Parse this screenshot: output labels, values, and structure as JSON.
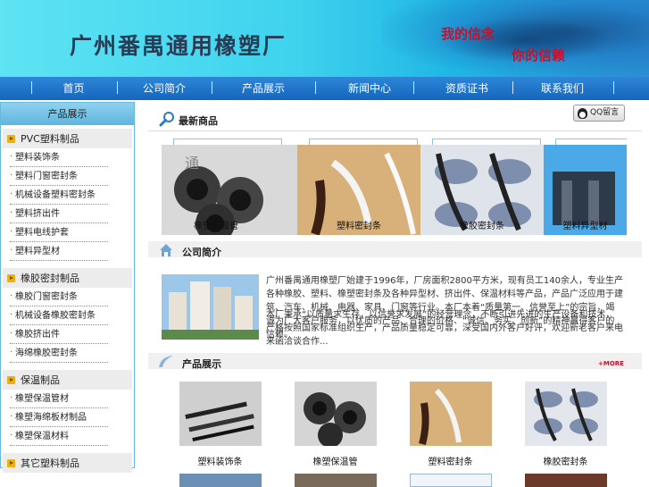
{
  "header": {
    "company": "广州番禺通用橡塑厂",
    "slogan_1": "我的信念",
    "slogan_2": "你的信赖"
  },
  "nav": {
    "items": [
      "首页",
      "公司简介",
      "产品展示",
      "新闻中心",
      "资质证书",
      "联系我们"
    ]
  },
  "sidebar": {
    "title": "产品展示",
    "categories": [
      {
        "label": "PVC塑料制品",
        "items": [
          "塑料装饰条",
          "塑料门窗密封条",
          "机械设备塑料密封条",
          "塑料挤出件",
          "塑料电线护套",
          "塑料异型材"
        ]
      },
      {
        "label": "橡胶密封制品",
        "items": [
          "橡胶门窗密封条",
          "机械设备橡胶密封条",
          "橡胶挤出件",
          "海绵橡胶密封条"
        ]
      },
      {
        "label": "保温制品",
        "items": [
          "橡塑保温管材",
          "橡塑海绵板材制品",
          "橡塑保温材料"
        ]
      },
      {
        "label": "其它塑料制品",
        "items": []
      }
    ]
  },
  "latest": {
    "title": "最新商品",
    "qq_label": "QQ留言",
    "cards": [
      "橡塑保温管",
      "塑料密封条",
      "橡胶密封条",
      "塑料异型材"
    ]
  },
  "about": {
    "title": "公司简介",
    "paragraph_1": "广州番禺通用橡塑厂始建于1996年，厂房面积2800平方米，现有员工140余人，专业生产各种橡胶、塑料、橡塑密封条及各种异型材、挤出件、保温材料等产品，产品广泛应用于建筑、汽车、机械、电器、家具、门窗等行业。本厂本着“质量第一、信誉至上”的宗旨，竭诚为广大客户服务，以优质的产品、合理的价格、“诚信、务实、创新”的精神赢得客户的信赖。",
    "paragraph_2": "本厂秉承“以质量求生存，以信誉求发展”的经营理念，不断引进先进的生产设备和技术，严格按照国家标准组织生产，产品质量稳定可靠，深受国内外客户好评，欢迎新老客户来电来函洽谈合作..."
  },
  "products": {
    "title": "产品展示",
    "more_label": "+MORE",
    "items": [
      "塑料装饰条",
      "橡塑保温管",
      "塑料密封条",
      "橡胶密封条"
    ]
  },
  "colors": {
    "nav": "#1f74c9",
    "accent": "#c8102e",
    "sidebar_border": "#68b9de"
  }
}
